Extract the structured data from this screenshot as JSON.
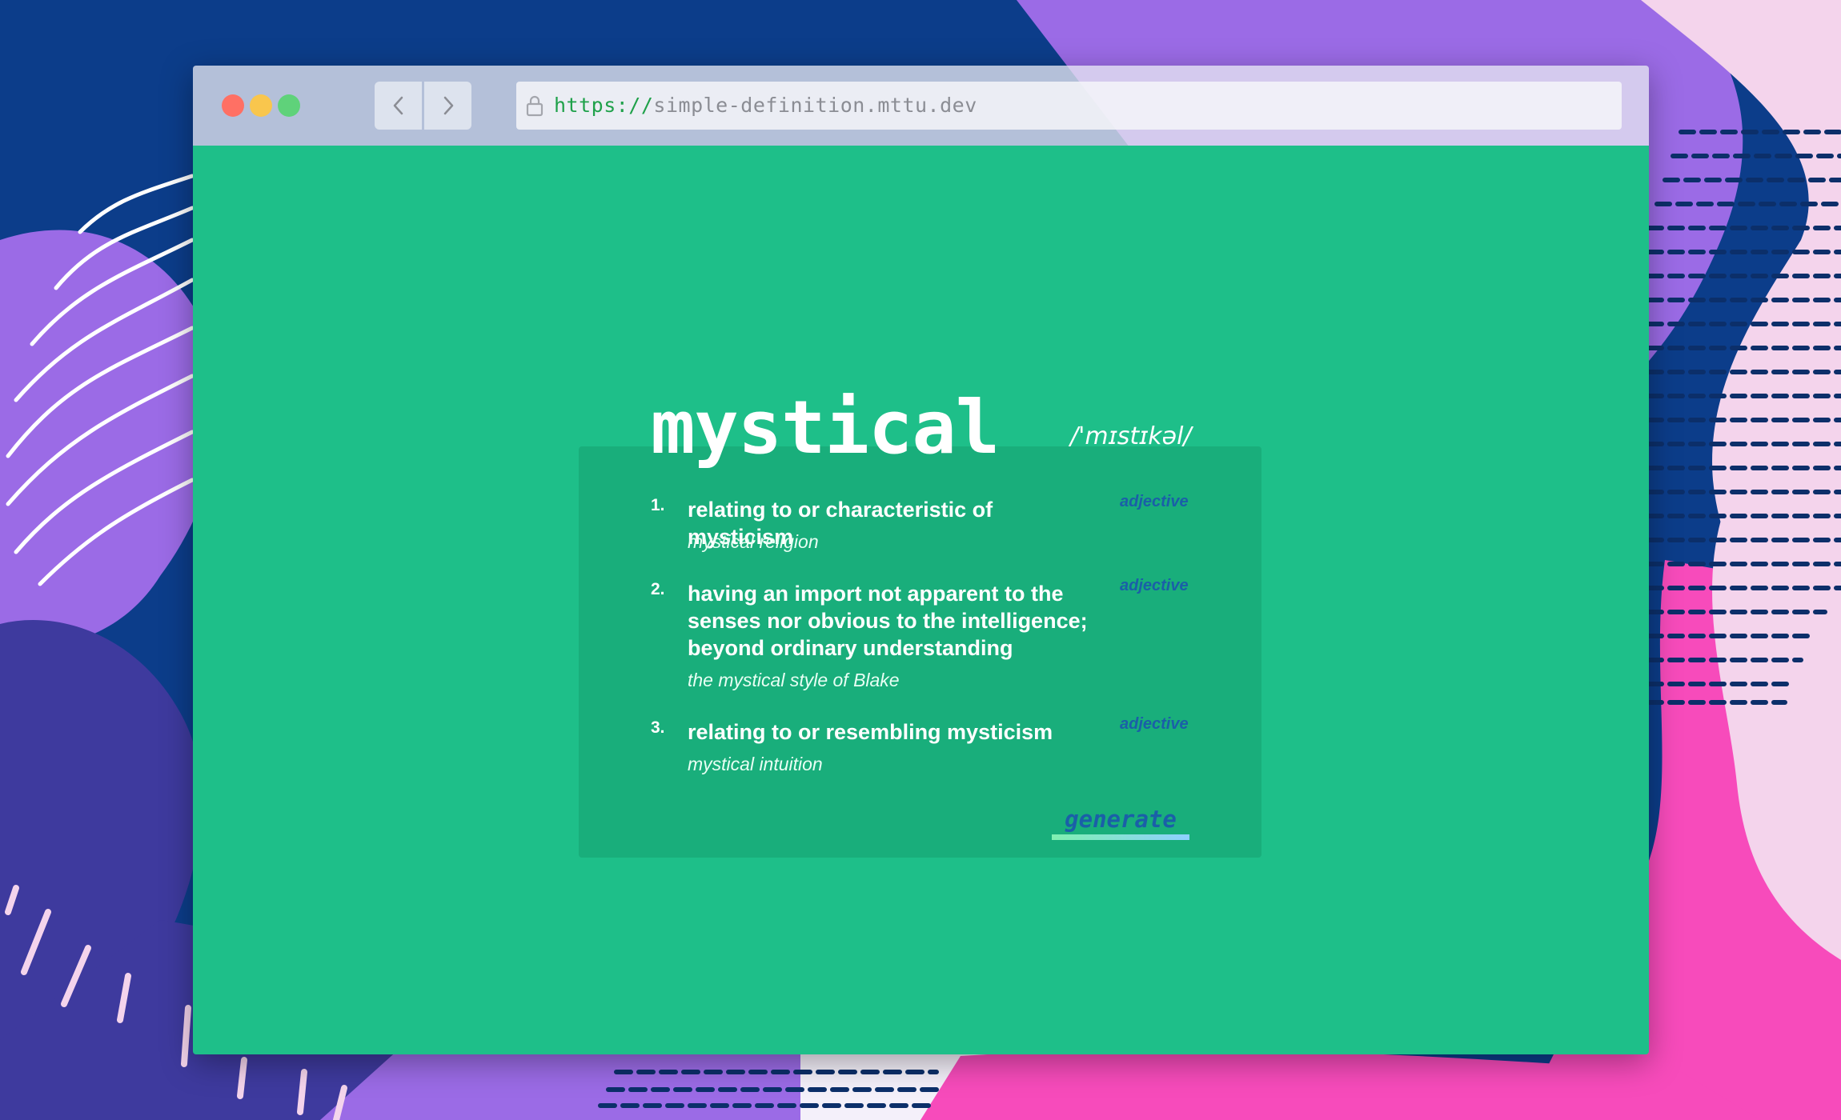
{
  "browser": {
    "url_scheme": "https://",
    "url_host": "simple-definition.mttu.dev",
    "icons": [
      "chevron-left-icon",
      "chevron-right-icon",
      "lock-icon"
    ]
  },
  "entry": {
    "word": "mystical",
    "phonetic": "/'mɪstɪkəl/",
    "definitions": [
      {
        "number": "1.",
        "text": "relating to or characteristic of mysticism",
        "example": "mystical religion",
        "part_of_speech": "adjective"
      },
      {
        "number": "2.",
        "text": "having an import not apparent to the senses nor obvious to the intelligence; beyond ordinary understanding",
        "example": "the mystical style of Blake",
        "part_of_speech": "adjective"
      },
      {
        "number": "3.",
        "text": "relating to or resembling mysticism",
        "example": "mystical intuition",
        "part_of_speech": "adjective"
      }
    ],
    "generate_label": "generate"
  },
  "colors": {
    "page_bg": "#1ebf89",
    "card_bg": "#19ae7b",
    "accent_blue": "#1a5fa8",
    "backdrop_navy": "#0c3d8a",
    "backdrop_purple": "#9b6be6",
    "backdrop_pink": "#f74bbb"
  }
}
